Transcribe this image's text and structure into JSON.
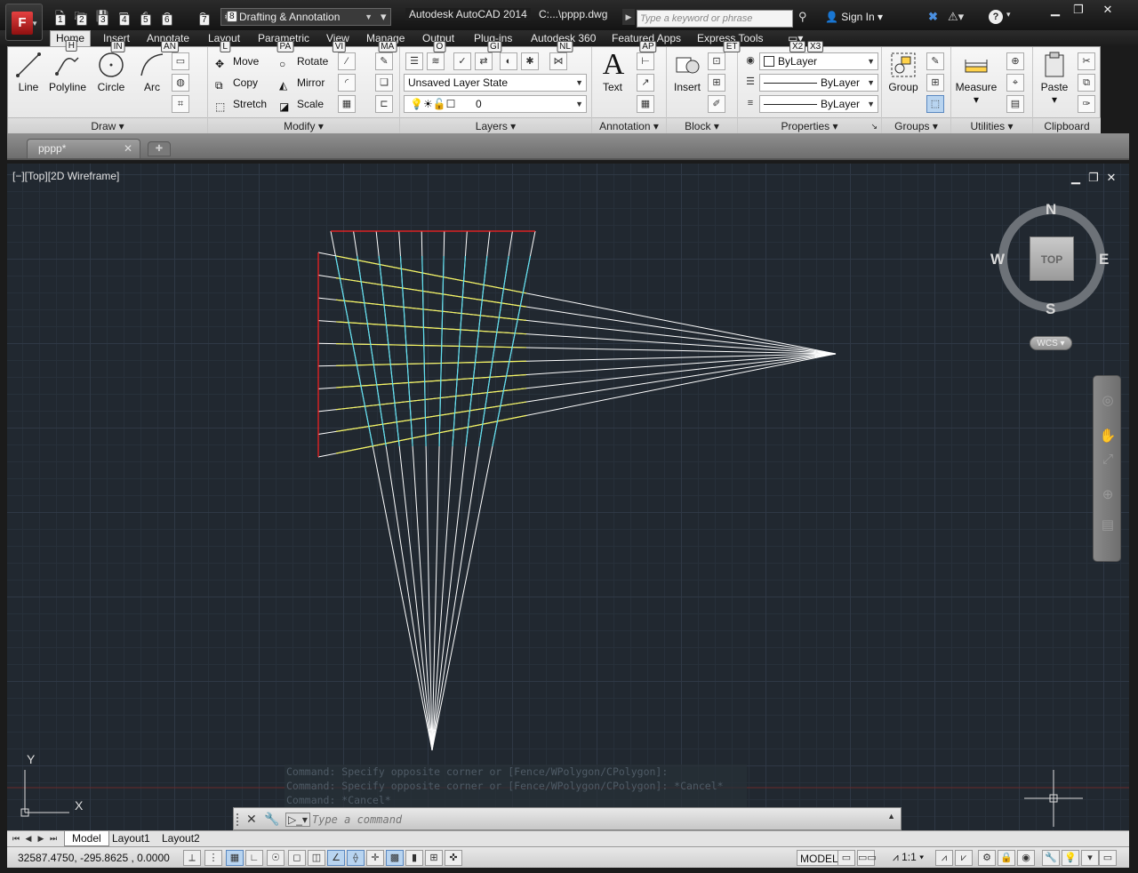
{
  "titlebar": {
    "app_button_letter": "F",
    "qat_keytips": [
      "1",
      "2",
      "3",
      "4",
      "5",
      "6",
      "7"
    ],
    "workspace": "Drafting & Annotation",
    "workspace_keytip": "8",
    "app_title": "Autodesk AutoCAD 2014",
    "doc_path": "C:...\\pppp.dwg",
    "search_placeholder": "Type a keyword or phrase",
    "signin": "Sign In",
    "help": "?"
  },
  "menu": {
    "tabs": [
      {
        "label": "Home",
        "keytip": "H"
      },
      {
        "label": "Insert",
        "keytip": "IN"
      },
      {
        "label": "Annotate",
        "keytip": "AN"
      },
      {
        "label": "Layout",
        "keytip": "L"
      },
      {
        "label": "Parametric",
        "keytip": "PA"
      },
      {
        "label": "View",
        "keytip": "VI"
      },
      {
        "label": "Manage",
        "keytip": "MA"
      },
      {
        "label": "Output",
        "keytip": "O"
      },
      {
        "label": "Plug-ins",
        "keytip": "GI"
      },
      {
        "label": "Autodesk 360",
        "keytip": "NL"
      },
      {
        "label": "Featured Apps",
        "keytip": "AP"
      },
      {
        "label": "Express Tools",
        "keytip": "ET"
      }
    ],
    "extra_keytips": [
      "X2",
      "X3"
    ]
  },
  "ribbon": {
    "draw": {
      "title": "Draw",
      "tools": [
        "Line",
        "Polyline",
        "Circle",
        "Arc"
      ]
    },
    "modify": {
      "title": "Modify",
      "tools": [
        "Move",
        "Rotate",
        "Copy",
        "Mirror",
        "Stretch",
        "Scale"
      ]
    },
    "layers": {
      "title": "Layers",
      "layer_state": "Unsaved Layer State",
      "current_layer": "0"
    },
    "annotation": {
      "title": "Annotation",
      "text": "Text"
    },
    "block": {
      "title": "Block",
      "insert": "Insert"
    },
    "properties": {
      "title": "Properties",
      "color": "ByLayer",
      "linetype": "ByLayer",
      "lineweight": "ByLayer"
    },
    "groups": {
      "title": "Groups",
      "group": "Group"
    },
    "utilities": {
      "title": "Utilities",
      "measure": "Measure"
    },
    "clipboard": {
      "title": "Clipboard",
      "paste": "Paste"
    }
  },
  "filetab": {
    "name": "pppp*"
  },
  "viewport": {
    "label": "[−][Top][2D Wireframe]",
    "viewcube": {
      "N": "N",
      "S": "S",
      "E": "E",
      "W": "W",
      "face": "TOP"
    },
    "wcs": "WCS",
    "ucs": {
      "x": "X",
      "y": "Y"
    }
  },
  "command": {
    "history": [
      "Command: Specify opposite corner or [Fence/WPolygon/CPolygon]:",
      "Command: Specify opposite corner or [Fence/WPolygon/CPolygon]: *Cancel*",
      "Command: *Cancel*"
    ],
    "placeholder": "Type a command"
  },
  "layout_tabs": [
    "Model",
    "Layout1",
    "Layout2"
  ],
  "status": {
    "coords": "32587.4750, -295.8625 , 0.0000",
    "model": "MODEL",
    "anno_scale": "1:1"
  },
  "colors": {
    "drawing_background": "#212830",
    "ray_lines": "#ffffff",
    "red_border": "#ff2020",
    "yellow_lines": "#f5f560",
    "cyan_lines": "#5ee0f0"
  }
}
